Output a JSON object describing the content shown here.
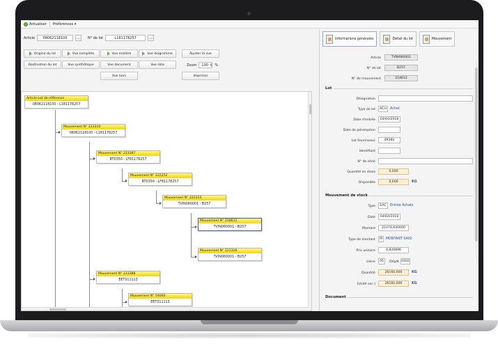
{
  "toolbar": {
    "refresh_label": "Actualiser",
    "prefs_label": "Préférences ▾"
  },
  "search": {
    "article_label": "Article",
    "article_value": "08062118100",
    "article_btn": "…",
    "lot_label": "N° de lot",
    "lot_value": "L181178257",
    "lot_btn": "…"
  },
  "buttons": {
    "origine": "Origine du lot",
    "complete": "Vue complète",
    "matiere": "Vue matière",
    "diagramme": "Vue diagramme",
    "ajuster": "Ajuster la vue",
    "destination": "Destination du lot",
    "synthetique": "Vue synthétique",
    "document": "Vue document",
    "liste": "Vue liste",
    "zoom_label": "Zoom",
    "zoom_value": "100",
    "zoom_unit": "%",
    "tiers": "Vue tiers",
    "imprimer": "Imprimer"
  },
  "tree": {
    "root": {
      "title": "Article-Lot de référence",
      "body": "08062118100 - L181178257"
    },
    "nodes": [
      {
        "title": "Mouvement N° 223310",
        "body": "08062118100 - L181178257"
      },
      {
        "title": "Mouvement N° 223387",
        "body": "RT0350 - LF81178257"
      },
      {
        "title": "Mouvement N° 222252",
        "body": "RT0350 - LF81178257"
      },
      {
        "title": "Mouvement N° 222253",
        "body": "TVIN060001 - B257"
      },
      {
        "title": "Mouvement N° 218612",
        "body": "TVIN060001 - B257"
      },
      {
        "title": "Mouvement N° 221326",
        "body": "TVIN060001 - B257"
      },
      {
        "title": "Mouvement N° 223388",
        "body": "EET011113"
      },
      {
        "title": "Mouvement N° 59360",
        "body": "EET011113"
      }
    ]
  },
  "panel": {
    "tabs": [
      "Informations générales",
      "Détail du lot",
      "Mouvement"
    ],
    "article_label": "Article",
    "article_value": "TVIN060001",
    "lot_label": "N° de lot",
    "lot_value": "B257",
    "mvt_label": "N° de mouvement",
    "mvt_value": "218612",
    "lot_section": "Lot",
    "designation_label": "Désignation",
    "designation_value": "",
    "type_lot_label": "Type de lot",
    "type_lot_code": "ACH",
    "type_lot_text": "Achat",
    "date_entree_label": "Date d'entrée",
    "date_entree_value": "04/04/2018",
    "peremption_label": "Date de péremption",
    "peremption_value": "",
    "lot_fourn_label": "Lot fournisseur",
    "lot_fourn_value": "0938V",
    "identifiant_label": "Identifiant",
    "identifiant_value": "",
    "serie_label": "N° de série",
    "serie_value": "",
    "qte_stock_label": "Quantité en stock",
    "qte_stock_value": "0,000",
    "disponible_label": "Disponible",
    "disponible_value": "0,000",
    "disponible_unit": "KG",
    "mvt_section": "Mouvement de stock",
    "type_label": "Type",
    "type_code": "EAC",
    "type_text": "Entrée Achats",
    "date_label": "Date",
    "date_value": "04/04/2018",
    "montant_label": "Montant",
    "montant_value": "21474,630000",
    "type_montant_label": "Type de montant",
    "type_montant_code": "M",
    "type_montant_text": "MONTANT SAISI",
    "prix_label": "Prix unitaire",
    "prix_value": "0,820896",
    "usine_label": "Usine",
    "usine_value": "05",
    "depot_label": "Dépôt",
    "depot_value": "0202",
    "quantite_label": "Quantité",
    "quantite_value": "26160,000",
    "quantite_unit": "KG",
    "unite_sec_label": "(Unité sec.)",
    "unite_sec_value": "26160,000",
    "unite_sec_unit": "KG",
    "document_section": "Document"
  }
}
